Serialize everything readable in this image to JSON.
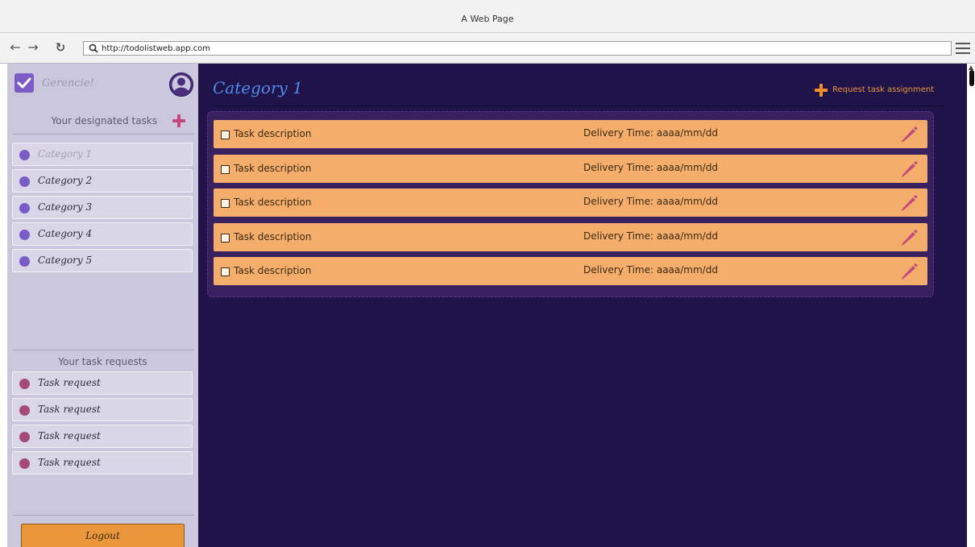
{
  "window": {
    "title": "A Web Page"
  },
  "browser": {
    "url": "http://todolistweb.app.com",
    "back_icon": "arrow-left-icon",
    "forward_icon": "arrow-right-icon",
    "reload_icon": "reload-icon",
    "menu_icon": "hamburger-menu-icon"
  },
  "sidebar": {
    "brand": {
      "name": "Gerencie!",
      "icon": "checkbox-checked-icon"
    },
    "user_icon": "user-avatar-icon",
    "designated": {
      "title": "Your designated tasks",
      "add_icon": "plus-icon",
      "items": [
        {
          "label": "Category 1",
          "active": true
        },
        {
          "label": "Category 2",
          "active": false
        },
        {
          "label": "Category 3",
          "active": false
        },
        {
          "label": "Category 4",
          "active": false
        },
        {
          "label": "Category 5",
          "active": false
        }
      ]
    },
    "requests": {
      "title": "Your task requests",
      "items": [
        {
          "label": "Task request"
        },
        {
          "label": "Task request"
        },
        {
          "label": "Task request"
        },
        {
          "label": "Task request"
        }
      ]
    },
    "logout_label": "Logout"
  },
  "main": {
    "title": "Category 1",
    "request_button": "Request task assignment",
    "tasks": [
      {
        "description": "Task description",
        "due": "Delivery Time: aaaa/mm/dd"
      },
      {
        "description": "Task description",
        "due": "Delivery Time: aaaa/mm/dd"
      },
      {
        "description": "Task description",
        "due": "Delivery Time: aaaa/mm/dd"
      },
      {
        "description": "Task description",
        "due": "Delivery Time: aaaa/mm/dd"
      },
      {
        "description": "Task description",
        "due": "Delivery Time: aaaa/mm/dd"
      }
    ]
  },
  "colors": {
    "page_bg": "#20134a",
    "sidebar_bg": "#cbc7dc",
    "category_dot": "#7a5cc7",
    "request_dot": "#a34a7a",
    "accent_orange": "#e9973a",
    "task_bg": "#f4ad6a",
    "title_blue": "#4e8bea",
    "edit_icon": "#c4497d"
  }
}
